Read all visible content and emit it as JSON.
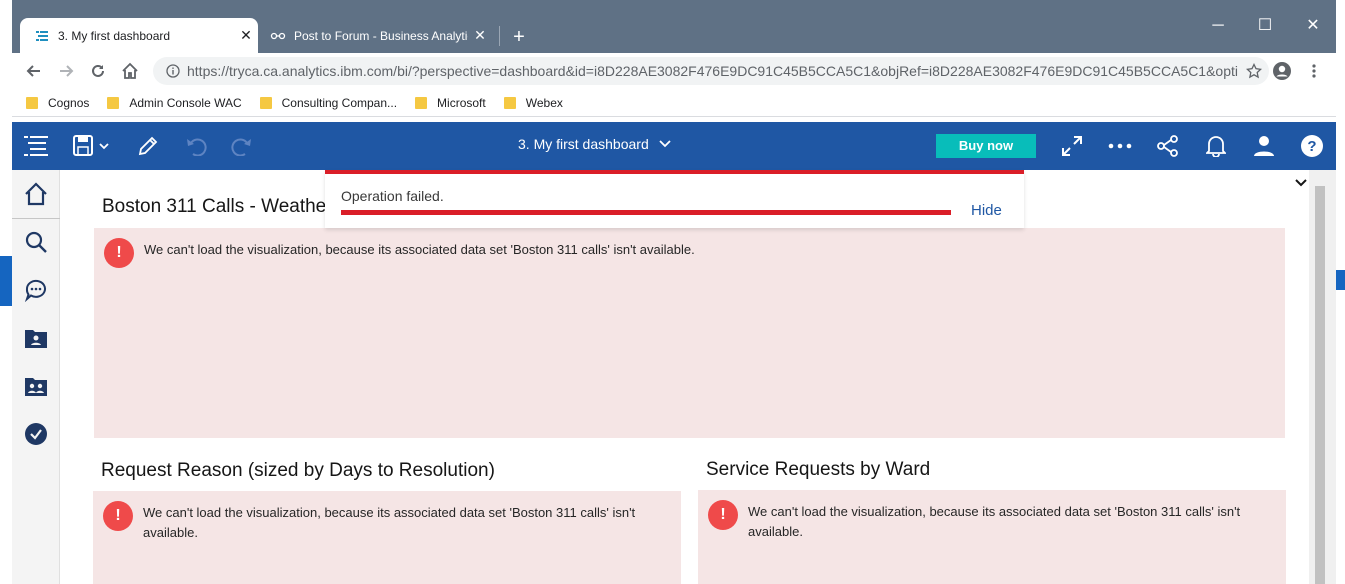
{
  "browser": {
    "tabs": [
      {
        "title": "3. My first dashboard",
        "close": "✕"
      },
      {
        "title": "Post to Forum - Business Analytics",
        "close": "✕"
      }
    ],
    "new_tab": "+",
    "window_controls": {
      "minimize": "─",
      "maximize": "☐",
      "close": "✕"
    },
    "url": "https://tryca.ca.analytics.ibm.com/bi/?perspective=dashboard&id=i8D228AE3082F476E9DC91C45B5CCA5C1&objRef=i8D228AE3082F476E9DC91C45B5CCA5C1&opti...",
    "bookmarks": [
      "Cognos",
      "Admin Console WAC",
      "Consulting Compan...",
      "Microsoft",
      "Webex"
    ]
  },
  "appbar": {
    "dashboard_title": "3. My first dashboard",
    "buy_now": "Buy now"
  },
  "toast": {
    "message": "Operation failed.",
    "hide": "Hide"
  },
  "widgets": {
    "top": {
      "title": "Boston 311 Calls - Weathe",
      "error": "We can't load the visualization, because its associated data set 'Boston 311 calls' isn't available."
    },
    "left": {
      "title": "Request Reason (sized by Days to Resolution)",
      "error_line1": "We can't load the visualization, because its associated data set 'Boston 311 calls' isn't",
      "error_line2": "available."
    },
    "right": {
      "title": "Service Requests by Ward",
      "error_line1": "We can't load the visualization, because its associated data set 'Boston 311 calls' isn't",
      "error_line2": "available."
    },
    "error_icon": "!"
  },
  "colors": {
    "appbar": "#1f57a4",
    "buy_now": "#08bdba",
    "error_red": "#da1e28",
    "error_bg": "#f5e5e5"
  }
}
